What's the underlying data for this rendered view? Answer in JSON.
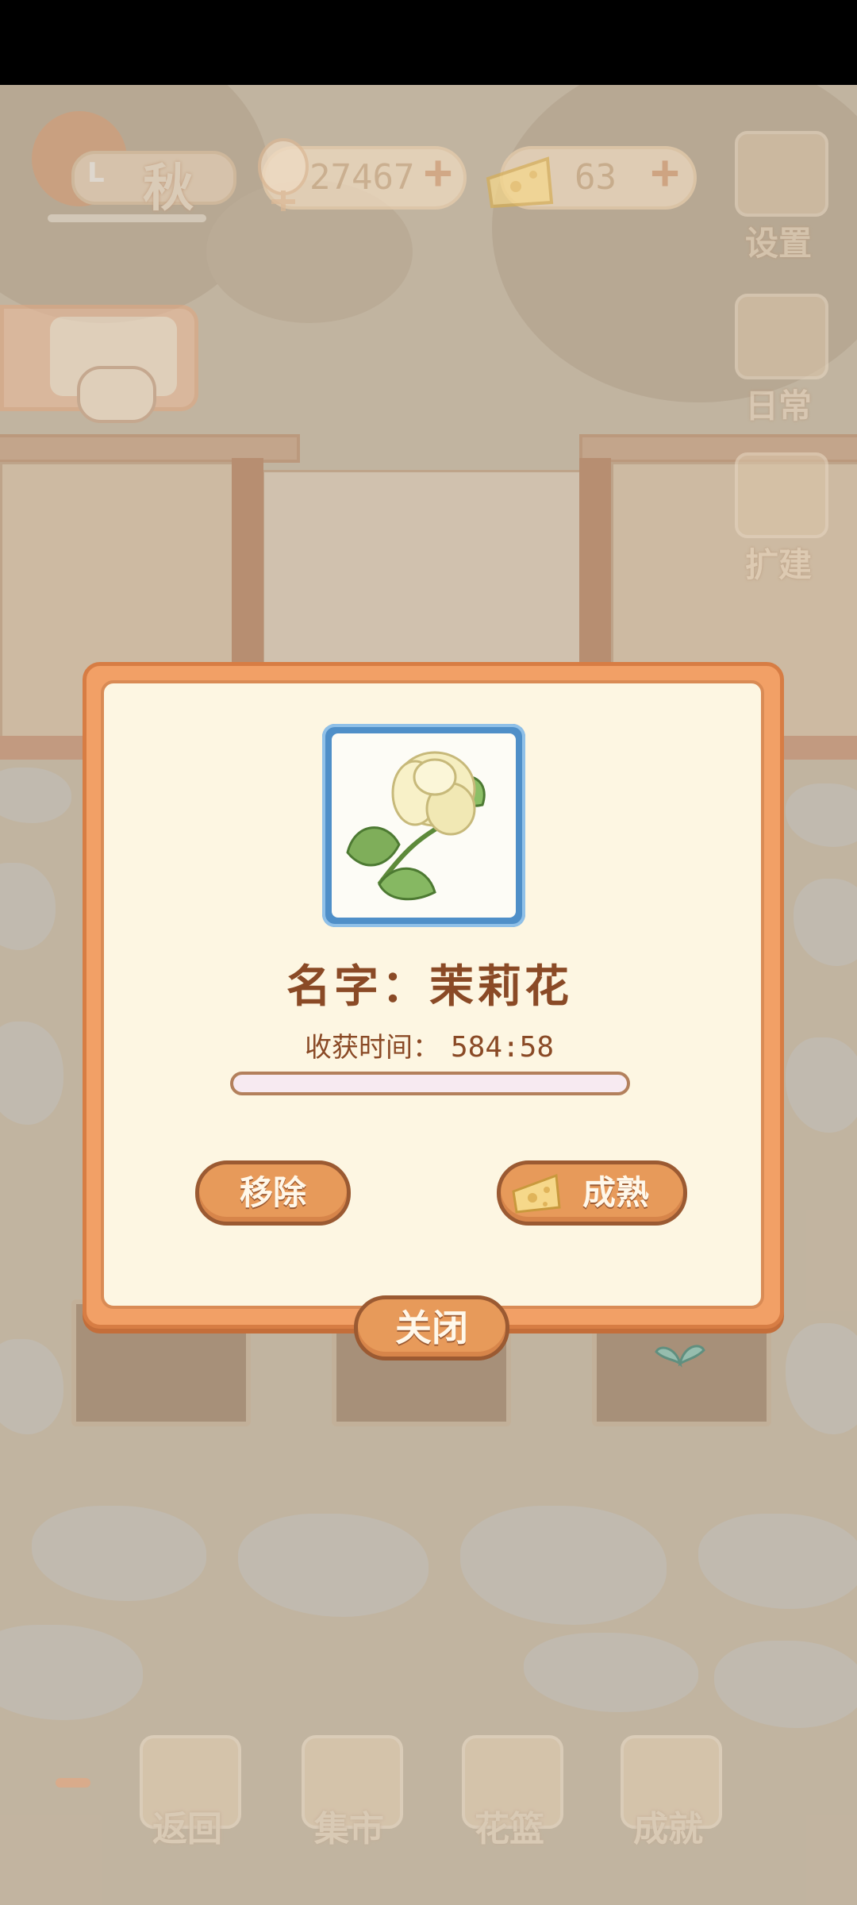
{
  "hud": {
    "season": "秋",
    "level_prefix": "L",
    "fish_count": "27467",
    "cheese_count": "63"
  },
  "side_menu": {
    "settings": "设置",
    "daily": "日常",
    "expand": "扩建"
  },
  "dialog": {
    "name_label": "名字：",
    "name_value": "茉莉花",
    "harvest_label": "收获时间：",
    "harvest_value": "584:58",
    "progress_fraction": 0.0,
    "remove_label": "移除",
    "mature_label": "成熟",
    "close_label": "关闭"
  },
  "bottom_nav": {
    "back": "返回",
    "market": "集市",
    "basket": "花篮",
    "achievement": "成就"
  },
  "colors": {
    "dialog_border": "#f2a066",
    "button_fill": "#e79a5a",
    "text_brown": "#8a4a26",
    "flower_frame": "#4f8fc8"
  }
}
